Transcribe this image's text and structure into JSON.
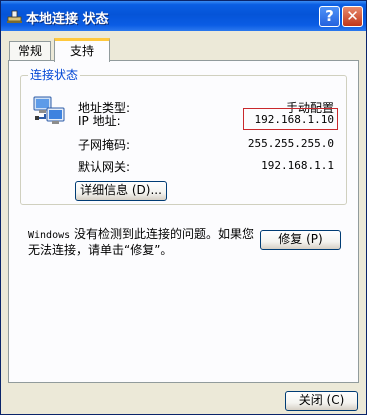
{
  "window": {
    "title": "本地连接 状态"
  },
  "titlebar": {
    "help_glyph": "?",
    "close_glyph": "✕"
  },
  "tabs": [
    {
      "label": "常规",
      "selected": false
    },
    {
      "label": "支持",
      "selected": true
    }
  ],
  "connection_status": {
    "group_title": "连接状态",
    "rows": [
      {
        "label": "地址类型:",
        "value": "手动配置"
      },
      {
        "label": "IP 地址:",
        "value": "192.168.1.10",
        "highlighted": true
      },
      {
        "label": "子网掩码:",
        "value": "255.255.255.0"
      },
      {
        "label": "默认网关:",
        "value": "192.168.1.1"
      }
    ],
    "details_button": "详细信息 (D)..."
  },
  "message": {
    "part1": "Windows",
    "part2": " 没有检测到此连接的问题。如果您无法连接，请单击“修复”。"
  },
  "repair_button": "修复 (P)",
  "close_button": "关闭 (C)",
  "colors": {
    "title_bar": "#0554d8",
    "highlight_border": "#c9282c",
    "group_title": "#0046d5"
  }
}
